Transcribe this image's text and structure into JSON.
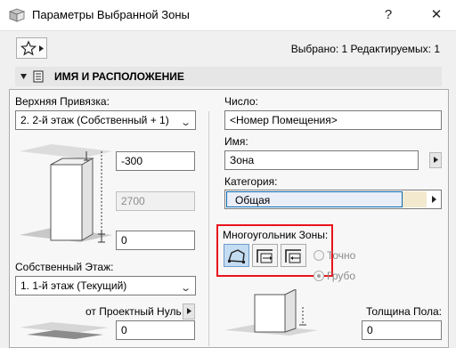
{
  "window": {
    "title": "Параметры Выбранной Зоны",
    "help": "?",
    "close": "✕"
  },
  "toolbar": {
    "selection_info": "Выбрано: 1 Редактируемых: 1"
  },
  "section": {
    "title": "ИМЯ И РАСПОЛОЖЕНИЕ"
  },
  "left": {
    "top_link_label": "Верхняя Привязка:",
    "top_link_value": "2. 2-й этаж (Собственный + 1)",
    "offset_top": "-300",
    "height": "2700",
    "offset_bottom": "0",
    "home_story_label": "Собственный Этаж:",
    "home_story_value": "1. 1-й этаж (Текущий)",
    "project_zero_label": "от Проектный Нуль",
    "project_zero_value": "0"
  },
  "right": {
    "number_label": "Число:",
    "number_value": "<Номер Помещения>",
    "name_label": "Имя:",
    "name_value": "Зона",
    "category_label": "Категория:",
    "category_value": "Общая",
    "category_color": "#f3e9cf",
    "polygon_label": "Многоугольник Зоны:",
    "precise_label": "Точно",
    "rough_label": "Грубо",
    "floor_thickness_label": "Толщина Пола:",
    "floor_thickness_value": "0"
  },
  "colors": {
    "highlight": "#e8141b",
    "panel_bg": "#f7f7f7",
    "section_bg": "#e6e6e6"
  },
  "icons": {
    "app": "zone-dialog-icon",
    "favorites": "star-icon",
    "section_toggle": "triangle-down-icon",
    "section": "document-icon"
  }
}
